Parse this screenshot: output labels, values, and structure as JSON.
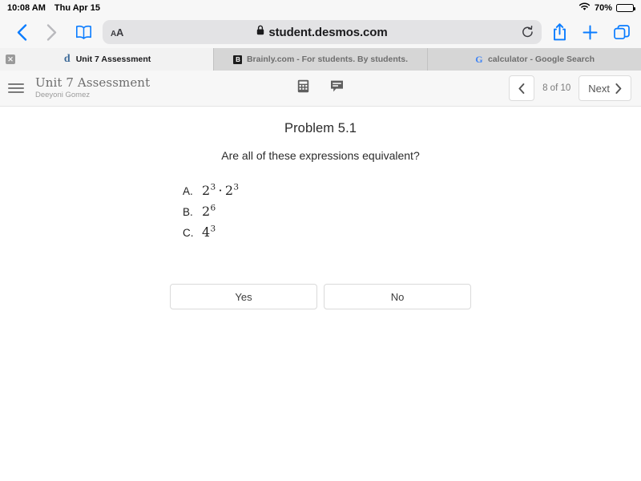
{
  "status_bar": {
    "time": "10:08 AM",
    "date": "Thu Apr 15",
    "wifi_icon": "wifi-icon",
    "battery_percent": "70%",
    "battery_level": 70
  },
  "browser": {
    "back_icon": "chevron-left-icon",
    "forward_icon": "chevron-right-icon",
    "bookmarks_icon": "book-icon",
    "text_size_label": "AA",
    "lock_icon": "lock-icon",
    "url": "student.desmos.com",
    "reload_icon": "reload-icon",
    "share_icon": "share-icon",
    "new_tab_icon": "plus-icon",
    "tabs_overview_icon": "tabs-icon",
    "close_tab_label": "✕",
    "tabs": [
      {
        "title": "Unit 7 Assessment",
        "favicon": "desmos-favicon",
        "favicon_glyph": "d",
        "active": true
      },
      {
        "title": "Brainly.com - For students. By students.",
        "favicon": "brainly-favicon",
        "favicon_glyph": "B",
        "active": false
      },
      {
        "title": "calculator - Google Search",
        "favicon": "google-favicon",
        "favicon_glyph": "G",
        "active": false
      }
    ]
  },
  "app_header": {
    "menu_icon": "hamburger-menu-icon",
    "assessment_title": "Unit 7 Assessment",
    "student_name": "Deeyoni Gomez",
    "calculator_icon": "calculator-icon",
    "comment_icon": "comment-icon",
    "prev_icon": "chevron-left-icon",
    "page_indicator": "8 of 10",
    "next_label": "Next",
    "next_icon": "chevron-right-icon"
  },
  "problem": {
    "title": "Problem 5.1",
    "question": "Are all of these expressions equivalent?",
    "choices": [
      {
        "letter": "A.",
        "base1": "2",
        "exp1": "3",
        "separator": "·",
        "base2": "2",
        "exp2": "3"
      },
      {
        "letter": "B.",
        "base1": "2",
        "exp1": "6"
      },
      {
        "letter": "C.",
        "base1": "4",
        "exp1": "3"
      }
    ],
    "answers": [
      {
        "label": "Yes"
      },
      {
        "label": "No"
      }
    ]
  },
  "colors": {
    "accent_blue": "#0a7cff",
    "chrome_grey": "#f7f7f7",
    "tab_inactive": "#d6d6d6"
  }
}
